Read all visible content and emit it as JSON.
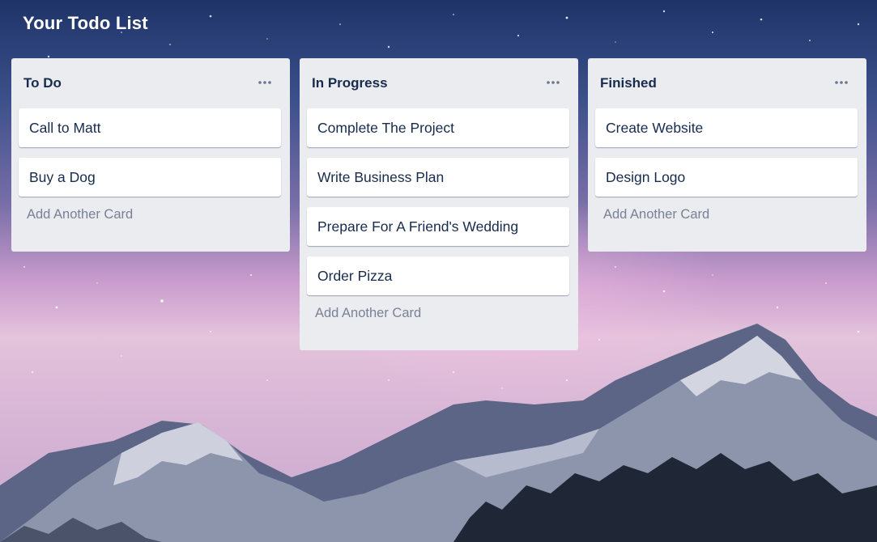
{
  "board": {
    "title": "Your Todo List"
  },
  "lists": [
    {
      "title": "To Do",
      "cards": [
        "Call to Matt",
        "Buy a Dog"
      ],
      "add_label": "Add Another Card",
      "menu_icon": "ellipsis-icon"
    },
    {
      "title": "In Progress",
      "cards": [
        "Complete The Project",
        "Write Business Plan",
        "Prepare For A Friend's Wedding",
        "Order Pizza"
      ],
      "add_label": "Add Another Card",
      "menu_icon": "ellipsis-icon"
    },
    {
      "title": "Finished",
      "cards": [
        "Create Website",
        "Design Logo"
      ],
      "add_label": "Add Another Card",
      "menu_icon": "ellipsis-icon"
    }
  ],
  "colors": {
    "list_bg": "#ebecf0",
    "card_bg": "#ffffff",
    "text": "#172b4d",
    "muted_text": "#7a8196"
  },
  "background": "starry-night-mountains"
}
